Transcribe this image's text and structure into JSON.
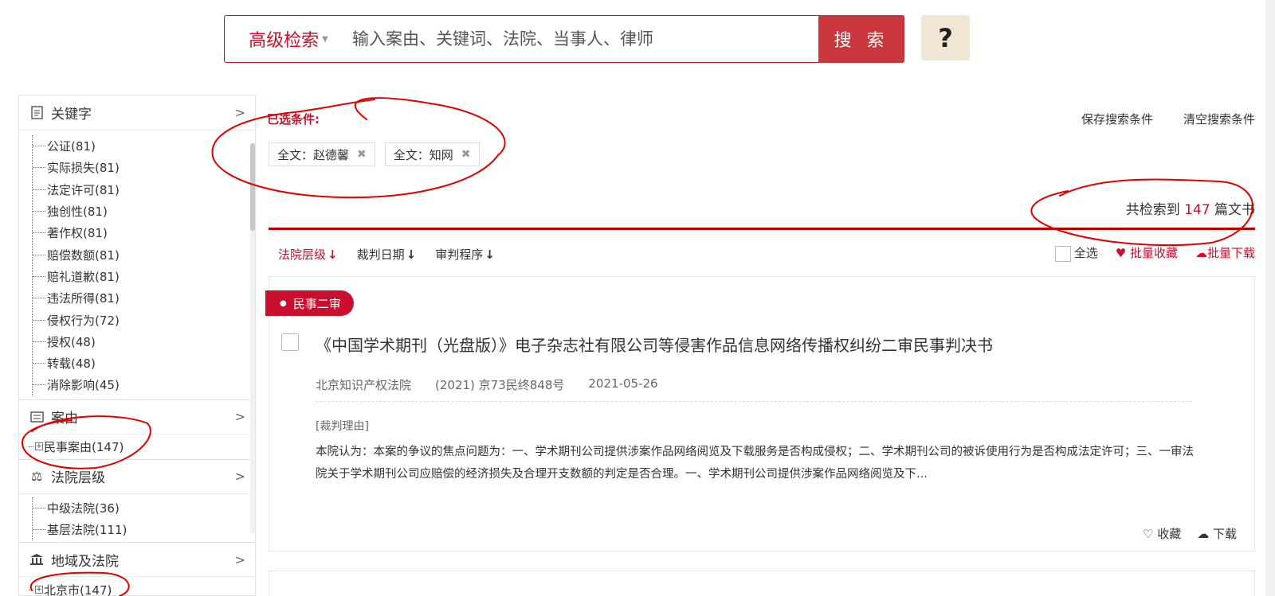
{
  "search": {
    "advanced_label": "高级检索",
    "placeholder": "输入案由、关键词、法院、当事人、律师",
    "button_label": "搜 索",
    "help_label": "?"
  },
  "sidebar": {
    "keyword": {
      "title": "关键字",
      "items": [
        "公证(81)",
        "实际损失(81)",
        "法定许可(81)",
        "独创性(81)",
        "著作权(81)",
        "赔偿数额(81)",
        "赔礼道歉(81)",
        "违法所得(81)",
        "侵权行为(72)",
        "授权(48)",
        "转载(48)",
        "消除影响(45)"
      ]
    },
    "case_type": {
      "title": "案由",
      "items": [
        "民事案由(147)"
      ]
    },
    "court_level": {
      "title": "法院层级",
      "items": [
        "中级法院(36)",
        "基层法院(111)"
      ]
    },
    "region": {
      "title": "地域及法院",
      "items": [
        "北京市(147)"
      ]
    }
  },
  "filters": {
    "label": "已选条件:",
    "chips": [
      "全文：赵德馨",
      "全文：知网"
    ],
    "save_label": "保存搜索条件",
    "clear_label": "清空搜索条件"
  },
  "results": {
    "prefix": "共检索到",
    "count": "147",
    "suffix": "篇文书"
  },
  "sort": {
    "court_level": "法院层级",
    "date": "裁判日期",
    "procedure": "审判程序",
    "select_all": "全选",
    "batch_fav": "批量收藏",
    "batch_download": "批量下载"
  },
  "card": {
    "badge": "民事二审",
    "title": "《中国学术期刊（光盘版）》电子杂志社有限公司等侵害作品信息网络传播权纠纷二审民事判决书",
    "court": "北京知识产权法院",
    "case_no": "(2021) 京73民终848号",
    "date": "2021-05-26",
    "reason_label": "[裁判理由]",
    "reason": "本院认为：本案的争议的焦点问题为：一、学术期刊公司提供涉案作品网络阅览及下载服务是否构成侵权；二、学术期刊公司的被诉使用行为是否构成法定许可；三、一审法院关于学术期刊公司应赔偿的经济损失及合理开支数额的判定是否合理。一、学术期刊公司提供涉案作品网络阅览及下...",
    "fav_label": "收藏",
    "download_label": "下载"
  },
  "colors": {
    "accent": "#c8102e",
    "search_button": "#c9363b",
    "help_bg": "#efe6d4",
    "annotation": "#e00000"
  }
}
